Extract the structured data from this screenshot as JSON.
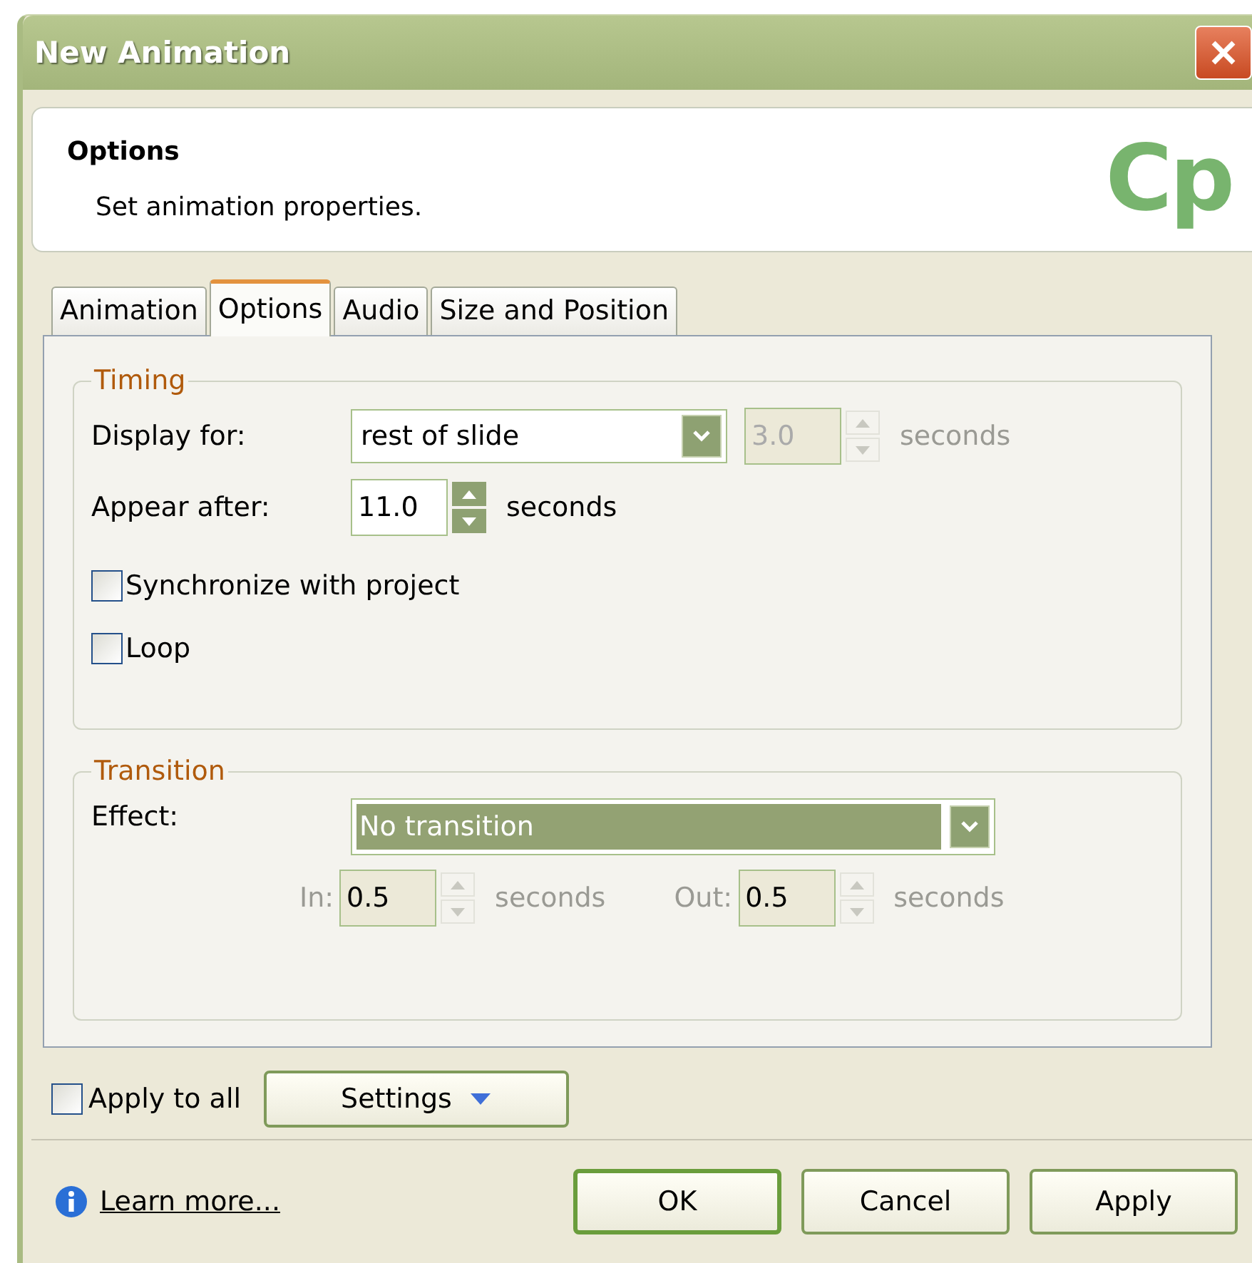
{
  "window": {
    "title": "New Animation"
  },
  "header": {
    "title": "Options",
    "subtitle": "Set animation properties.",
    "logo": "Cp"
  },
  "tabs": [
    {
      "label": "Animation",
      "selected": false
    },
    {
      "label": "Options",
      "selected": true
    },
    {
      "label": "Audio",
      "selected": false
    },
    {
      "label": "Size and Position",
      "selected": false
    }
  ],
  "timing": {
    "legend": "Timing",
    "display_for": {
      "label": "Display for:",
      "value": "rest of slide",
      "duration": "3.0",
      "duration_disabled": true,
      "unit": "seconds"
    },
    "appear_after": {
      "label": "Appear after:",
      "value": "11.0",
      "disabled": false,
      "unit": "seconds"
    },
    "checkboxes": [
      {
        "label": "Synchronize with project",
        "checked": false
      },
      {
        "label": "Loop",
        "checked": false
      }
    ]
  },
  "transition": {
    "legend": "Transition",
    "effect": {
      "label": "Effect:",
      "value": "No transition",
      "focused": true
    },
    "spinners": [
      {
        "label": "In:",
        "value": "0.5",
        "disabled": true,
        "unit": "seconds"
      },
      {
        "label": "Out:",
        "value": "0.5",
        "disabled": true,
        "unit": "seconds"
      }
    ]
  },
  "apply_to_all": {
    "label": "Apply to all",
    "checked": false
  },
  "settings_button": "Settings",
  "learn_more": "Learn more...",
  "buttons": [
    {
      "label": "OK",
      "default": true
    },
    {
      "label": "Cancel",
      "default": false
    },
    {
      "label": "Apply",
      "default": false
    }
  ]
}
